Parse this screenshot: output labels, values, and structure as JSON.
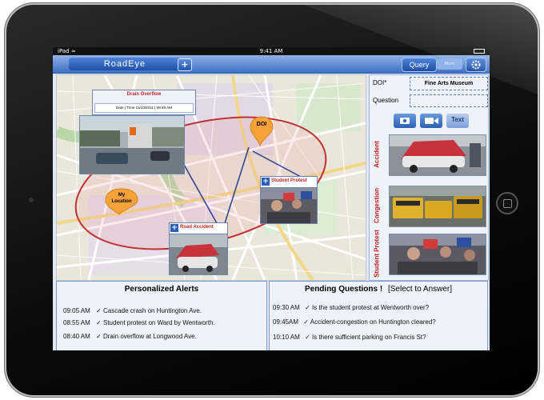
{
  "status_bar": {
    "device": "iPad",
    "time": "9:41 AM"
  },
  "header": {
    "app_name": "RoadEye",
    "add_label": "+",
    "query_label": "Query",
    "more_label": "More"
  },
  "map": {
    "drain_title": "Drain Overflow",
    "drain_datetime": "Date | Time 11/10/2011 | 08:40 AM",
    "doi_pin": "DOI",
    "my_location_pin": "My Location",
    "student_protest_label": "Student Protest",
    "road_accident_label": "Road Accident"
  },
  "query_panel": {
    "doi_label": "DOI*",
    "doi_value": "Fine Arts Museum",
    "question_label": "Question",
    "text_button_label": "Text",
    "categories": [
      {
        "label": "Accident"
      },
      {
        "label": "Congestion"
      },
      {
        "label": "Student Protest"
      }
    ]
  },
  "alerts": {
    "title": "Personalized Alerts",
    "items": [
      {
        "time": "09:05 AM",
        "text": "Cascade crash on Huntington Ave."
      },
      {
        "time": "08:55 AM",
        "text": "Student protest on Ward by Wentworth."
      },
      {
        "time": "08:40 AM",
        "text": "Drain overflow at Longwood Ave."
      }
    ]
  },
  "pending": {
    "title": "Pending Questions !",
    "hint": "[Select to Answer]",
    "items": [
      {
        "time": "09:30 AM",
        "text": "Is the student protest at Wentworth over?"
      },
      {
        "time": "09:45AM",
        "text": "Accident-congestion on Huntington cleared?"
      },
      {
        "time": "10:10 AM",
        "text": "Is there sufficient parking on Francis St?"
      }
    ]
  },
  "check_mark": "✓"
}
